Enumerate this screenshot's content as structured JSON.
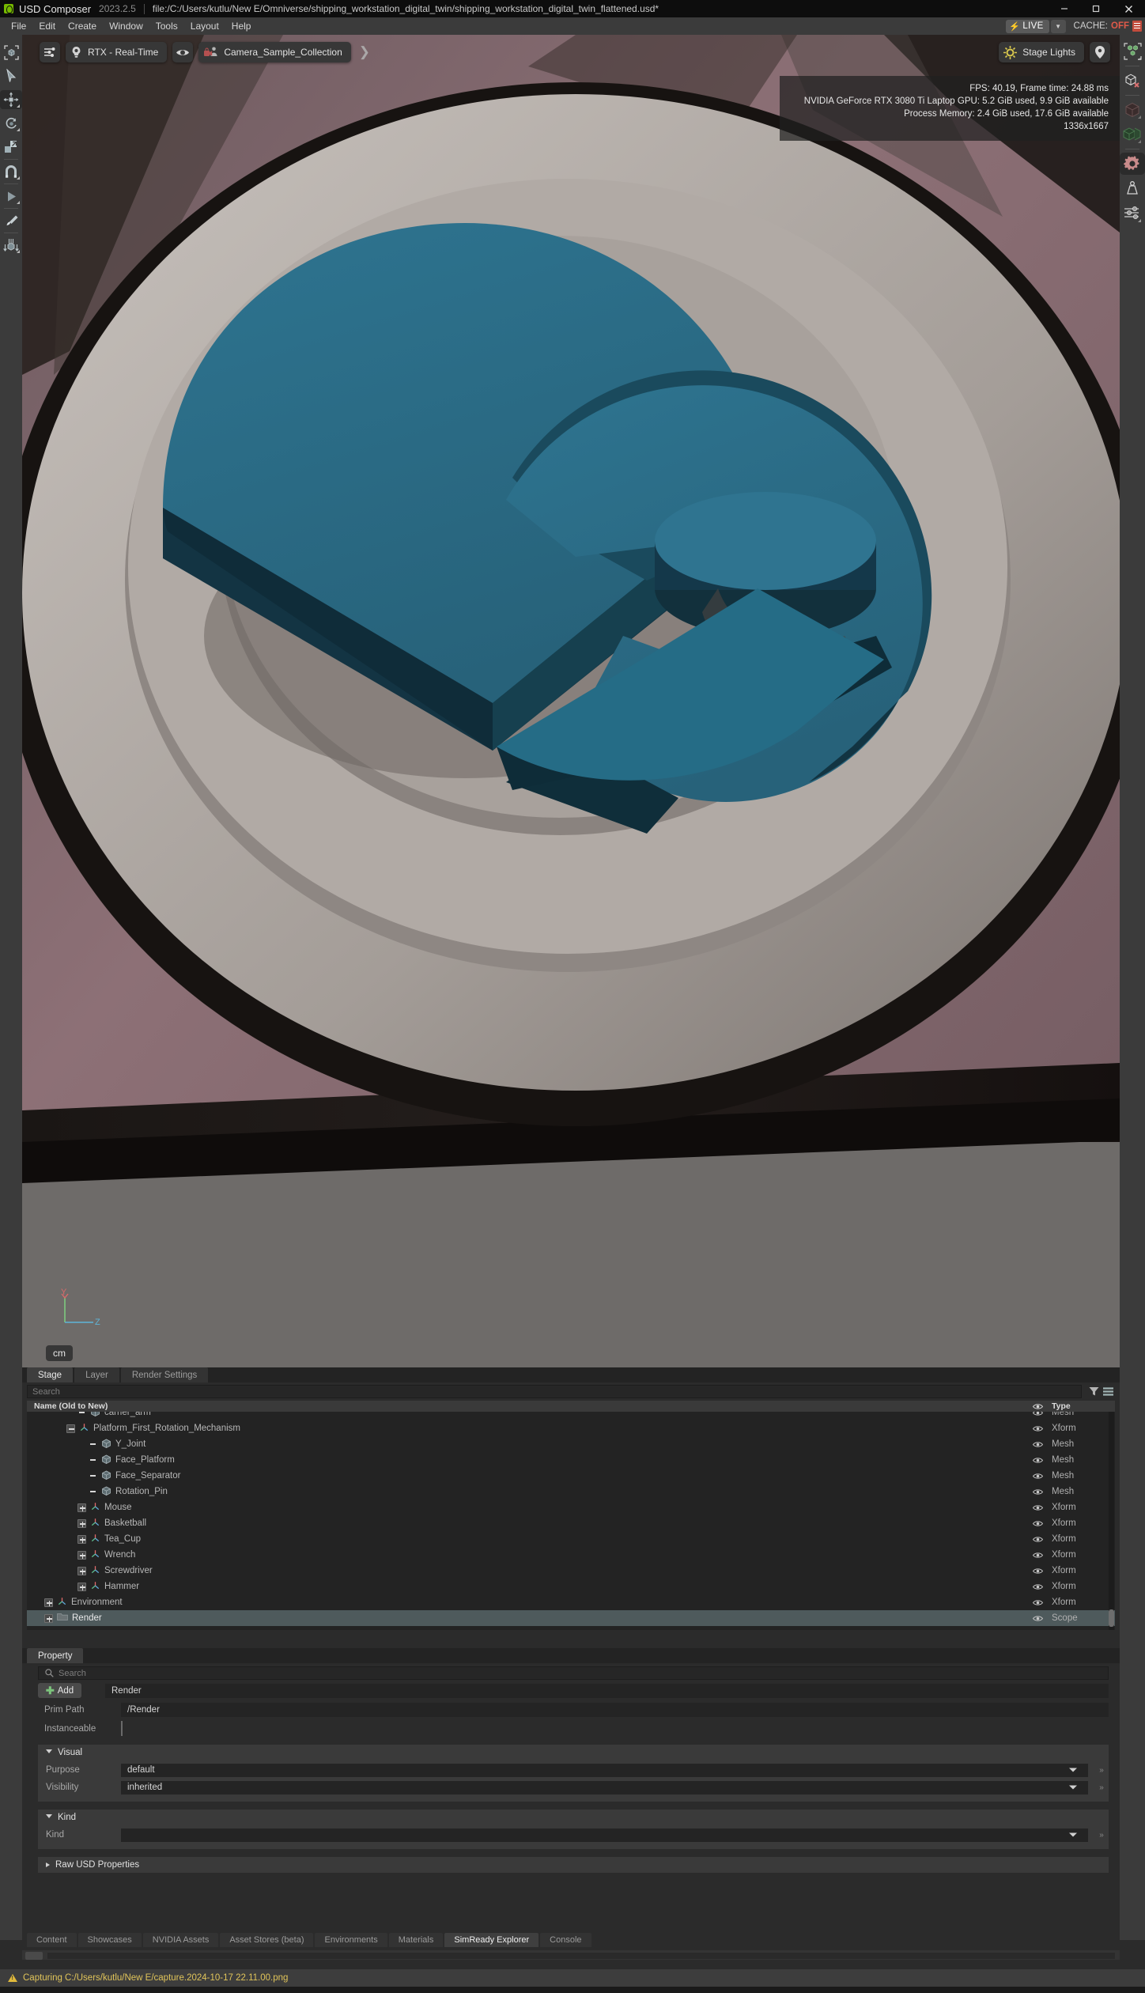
{
  "titlebar": {
    "app_name": "USD Composer",
    "version": "2023.2.5",
    "file_path": "file:/C:/Users/kutlu/New E/Omniverse/shipping_workstation_digital_twin/shipping_workstation_digital_twin_flattened.usd*",
    "minimize": "—",
    "maximize": "◻",
    "close": "✕"
  },
  "menubar": {
    "items": [
      "File",
      "Edit",
      "Create",
      "Window",
      "Tools",
      "Layout",
      "Help"
    ],
    "live_label": "LIVE",
    "cache_label": "CACHE:",
    "cache_value": "OFF"
  },
  "viewport": {
    "renderer_label": "RTX - Real-Time",
    "camera_label": "Camera_Sample_Collection",
    "stage_lights_label": "Stage Lights",
    "unit_label": "cm",
    "axis_y": "Y",
    "axis_z": "Z",
    "stats": [
      "FPS: 40.19, Frame time: 24.88 ms",
      "NVIDIA GeForce RTX 3080 Ti Laptop GPU: 5.2 GiB used, 9.9 GiB available",
      "Process Memory: 2.4 GiB used, 17.6 GiB available",
      "1336x1667"
    ]
  },
  "left_rail": [
    {
      "name": "select-bound-box-tool"
    },
    {
      "name": "select-arrow-tool"
    },
    {
      "name": "move-tool"
    },
    {
      "name": "rotate-tool"
    },
    {
      "name": "scale-tool"
    },
    {
      "name": "snap-magnet-tool"
    },
    {
      "name": "play-tool"
    },
    {
      "name": "paint-brush-tool"
    },
    {
      "name": "align-distribute-tool"
    }
  ],
  "right_rail": [
    {
      "name": "select-multiple-prims-icon"
    },
    {
      "name": "hide-unselected-icon"
    },
    {
      "name": "dark-cube-icon"
    },
    {
      "name": "green-cubes-icon"
    },
    {
      "name": "settings-gear-icon"
    },
    {
      "name": "physics-weight-icon"
    },
    {
      "name": "sliders-icon"
    }
  ],
  "stage": {
    "tabs": [
      {
        "label": "Stage",
        "active": true
      },
      {
        "label": "Layer",
        "active": false
      },
      {
        "label": "Render Settings",
        "active": false
      }
    ],
    "search_placeholder": "Search",
    "columns": {
      "name": "Name (Old to New)",
      "type": "Type"
    },
    "rows": [
      {
        "label": "carrier_arm",
        "type": "Mesh",
        "indent": 4,
        "expander": "none",
        "icon": "mesh-cube-icon",
        "selected": false,
        "clipped": true
      },
      {
        "label": "Platform_First_Rotation_Mechanism",
        "type": "Xform",
        "indent": 3,
        "expander": "minus",
        "icon": "xform-axis-icon",
        "selected": false
      },
      {
        "label": "Y_Joint",
        "type": "Mesh",
        "indent": 5,
        "expander": "none",
        "icon": "mesh-cube-icon",
        "selected": false
      },
      {
        "label": "Face_Platform",
        "type": "Mesh",
        "indent": 5,
        "expander": "none",
        "icon": "mesh-cube-icon",
        "selected": false
      },
      {
        "label": "Face_Separator",
        "type": "Mesh",
        "indent": 5,
        "expander": "none",
        "icon": "mesh-cube-icon",
        "selected": false
      },
      {
        "label": "Rotation_Pin",
        "type": "Mesh",
        "indent": 5,
        "expander": "none",
        "icon": "mesh-cube-icon",
        "selected": false
      },
      {
        "label": "Mouse",
        "type": "Xform",
        "indent": 4,
        "expander": "plus",
        "icon": "xform-axis-icon",
        "selected": false
      },
      {
        "label": "Basketball",
        "type": "Xform",
        "indent": 4,
        "expander": "plus",
        "icon": "xform-axis-icon",
        "selected": false
      },
      {
        "label": "Tea_Cup",
        "type": "Xform",
        "indent": 4,
        "expander": "plus",
        "icon": "xform-axis-icon",
        "selected": false
      },
      {
        "label": "Wrench",
        "type": "Xform",
        "indent": 4,
        "expander": "plus",
        "icon": "xform-axis-icon",
        "selected": false
      },
      {
        "label": "Screwdriver",
        "type": "Xform",
        "indent": 4,
        "expander": "plus",
        "icon": "xform-axis-icon",
        "selected": false
      },
      {
        "label": "Hammer",
        "type": "Xform",
        "indent": 4,
        "expander": "plus",
        "icon": "xform-axis-icon",
        "selected": false
      },
      {
        "label": "Environment",
        "type": "Xform",
        "indent": 1,
        "expander": "plus",
        "icon": "xform-axis-icon",
        "selected": false
      },
      {
        "label": "Render",
        "type": "Scope",
        "indent": 1,
        "expander": "plus",
        "icon": "scope-folder-icon",
        "selected": true
      }
    ]
  },
  "property": {
    "tab_label": "Property",
    "search_placeholder": "Search",
    "add_label": "Add",
    "name_value": "Render",
    "prim_path_label": "Prim Path",
    "prim_path_value": "/Render",
    "instanceable_label": "Instanceable",
    "sections": [
      {
        "title": "Visual",
        "expanded": true,
        "rows": [
          {
            "label": "Purpose",
            "value": "default",
            "dropdown": true
          },
          {
            "label": "Visibility",
            "value": "inherited",
            "dropdown": true
          }
        ]
      },
      {
        "title": "Kind",
        "expanded": true,
        "rows": [
          {
            "label": "Kind",
            "value": "",
            "dropdown": true
          }
        ]
      },
      {
        "title": "Raw USD Properties",
        "expanded": false,
        "rows": []
      }
    ]
  },
  "bottom_tabs": [
    {
      "label": "Content",
      "active": false
    },
    {
      "label": "Showcases",
      "active": false
    },
    {
      "label": "NVIDIA Assets",
      "active": false
    },
    {
      "label": "Asset Stores (beta)",
      "active": false
    },
    {
      "label": "Environments",
      "active": false
    },
    {
      "label": "Materials",
      "active": false
    },
    {
      "label": "SimReady Explorer",
      "active": true
    },
    {
      "label": "Console",
      "active": false
    }
  ],
  "statusbar": {
    "message": "Capturing C:/Users/kutlu/New E/capture.2024-10-17 22.11.00.png"
  },
  "colors": {
    "accent_green": "#76b900",
    "warning": "#e0c45a",
    "cache_off": "#e05a4a",
    "selection": "#4e5a5c",
    "mesh_teal": "#2b6e85"
  }
}
